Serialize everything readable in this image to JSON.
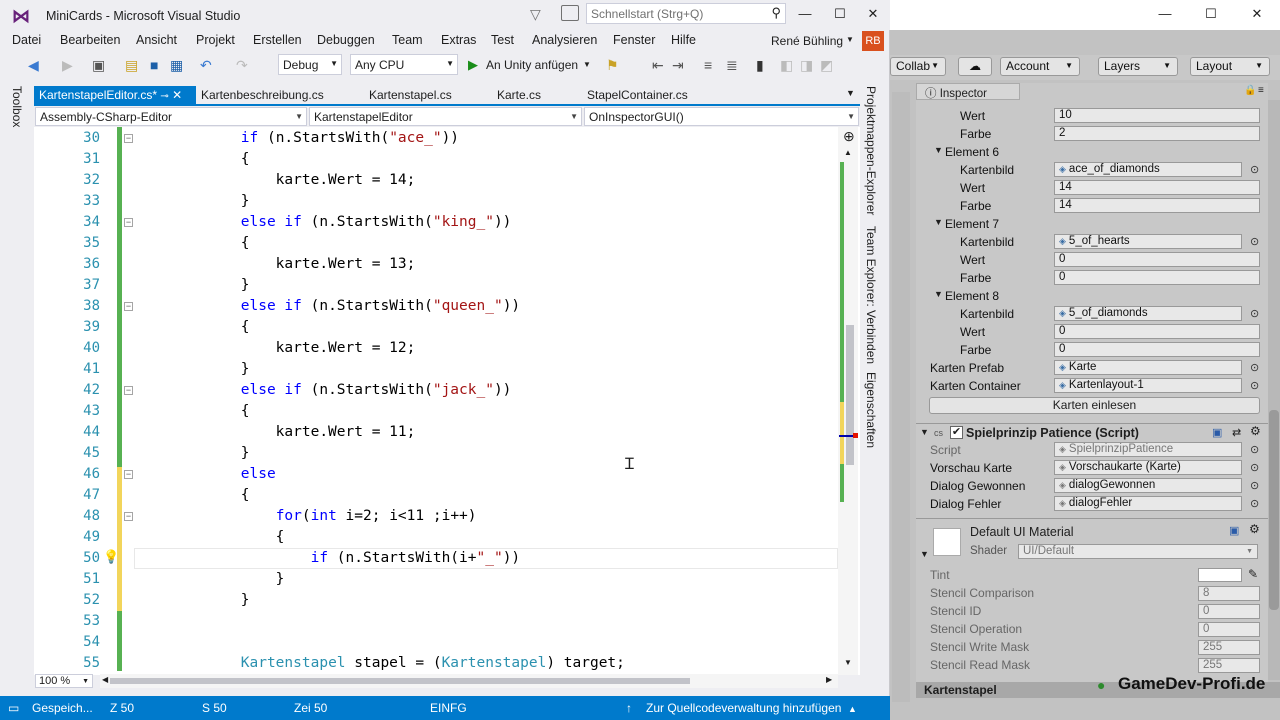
{
  "vs": {
    "title": "MiniCards - Microsoft Visual Studio",
    "quicklaunch_placeholder": "Schnellstart (Strg+Q)",
    "menu": [
      "Datei",
      "Bearbeiten",
      "Ansicht",
      "Projekt",
      "Erstellen",
      "Debuggen",
      "Team",
      "Extras",
      "Test",
      "Analysieren",
      "Fenster",
      "Hilfe"
    ],
    "user": "René Bühling",
    "user_initials": "RB",
    "toolbar": {
      "config": "Debug",
      "platform": "Any CPU",
      "attach": "An Unity anfügen"
    },
    "toolbox": "Toolbox",
    "tabs": [
      "KartenstapelEditor.cs*",
      "Kartenbeschreibung.cs",
      "Kartenstapel.cs",
      "Karte.cs",
      "StapelContainer.cs"
    ],
    "nav": {
      "project": "Assembly-CSharp-Editor",
      "class": "KartenstapelEditor",
      "member": "OnInspectorGUI()"
    },
    "line_numbers": [
      "30",
      "31",
      "32",
      "33",
      "34",
      "35",
      "36",
      "37",
      "38",
      "39",
      "40",
      "41",
      "42",
      "43",
      "44",
      "45",
      "46",
      "47",
      "48",
      "49",
      "50",
      "51",
      "52",
      "53",
      "54",
      "55"
    ],
    "code_lines": [
      "            if (n.StartsWith(\"ace_\"))",
      "            {",
      "                karte.Wert = 14;",
      "            }",
      "            else if (n.StartsWith(\"king_\"))",
      "            {",
      "                karte.Wert = 13;",
      "            }",
      "            else if (n.StartsWith(\"queen_\"))",
      "            {",
      "                karte.Wert = 12;",
      "            }",
      "            else if (n.StartsWith(\"jack_\"))",
      "            {",
      "                karte.Wert = 11;",
      "            }",
      "            else",
      "            {",
      "                for(int i=2; i<11 ;i++)",
      "                {",
      "                    if (n.StartsWith(i+\"_\"))",
      "                }",
      "            }",
      "",
      "",
      "            Kartenstapel stapel = (Kartenstapel) target;"
    ],
    "zoom": "100 %",
    "right_panels": [
      "Projektmappen-Explorer",
      "Team Explorer: Verbinden",
      "Eigenschaften"
    ],
    "status": {
      "saving": "Gespeich...",
      "z": "Z 50",
      "s": "S 50",
      "zei": "Zei 50",
      "mode": "EINFG",
      "source_control": "Zur Quellcodeverwaltung hinzufügen"
    }
  },
  "unity": {
    "toolbar": [
      "Collab",
      "Account",
      "Layers",
      "Layout"
    ],
    "inspector_tab": "Inspector",
    "rows": [
      {
        "label": "Wert",
        "value": "10",
        "indent": 2
      },
      {
        "label": "Farbe",
        "value": "2",
        "indent": 2
      },
      {
        "label": "Element 6",
        "value": "",
        "indent": 1,
        "foldout": true
      },
      {
        "label": "Kartenbild",
        "value": "ace_of_diamonds",
        "indent": 2,
        "obj": true
      },
      {
        "label": "Wert",
        "value": "14",
        "indent": 2
      },
      {
        "label": "Farbe",
        "value": "14",
        "indent": 2
      },
      {
        "label": "Element 7",
        "value": "",
        "indent": 1,
        "foldout": true
      },
      {
        "label": "Kartenbild",
        "value": "5_of_hearts",
        "indent": 2,
        "obj": true
      },
      {
        "label": "Wert",
        "value": "0",
        "indent": 2
      },
      {
        "label": "Farbe",
        "value": "0",
        "indent": 2
      },
      {
        "label": "Element 8",
        "value": "",
        "indent": 1,
        "foldout": true
      },
      {
        "label": "Kartenbild",
        "value": "5_of_diamonds",
        "indent": 2,
        "obj": true
      },
      {
        "label": "Wert",
        "value": "0",
        "indent": 2
      },
      {
        "label": "Farbe",
        "value": "0",
        "indent": 2
      },
      {
        "label": "Karten Prefab",
        "value": "Karte",
        "indent": 0,
        "obj": true
      },
      {
        "label": "Karten Container",
        "value": "Kartenlayout-1",
        "indent": 0,
        "obj": true
      }
    ],
    "load_button": "Karten einlesen",
    "script_component": "Spielprinzip Patience (Script)",
    "script_rows": [
      {
        "label": "Script",
        "value": "SpielprinzipPatience",
        "dim": true
      },
      {
        "label": "Vorschau Karte",
        "value": "Vorschaukarte (Karte)"
      },
      {
        "label": "Dialog Gewonnen",
        "value": "dialogGewonnen"
      },
      {
        "label": "Dialog Fehler",
        "value": "dialogFehler"
      }
    ],
    "material": {
      "name": "Default UI Material",
      "shader_label": "Shader",
      "shader": "UI/Default"
    },
    "mat_rows": [
      {
        "label": "Tint",
        "value": ""
      },
      {
        "label": "Stencil Comparison",
        "value": "8"
      },
      {
        "label": "Stencil ID",
        "value": "0"
      },
      {
        "label": "Stencil Operation",
        "value": "0"
      },
      {
        "label": "Stencil Write Mask",
        "value": "255"
      },
      {
        "label": "Stencil Read Mask",
        "value": "255"
      }
    ],
    "footer": "Kartenstapel",
    "watermark": "GameDev-Profi.de"
  }
}
